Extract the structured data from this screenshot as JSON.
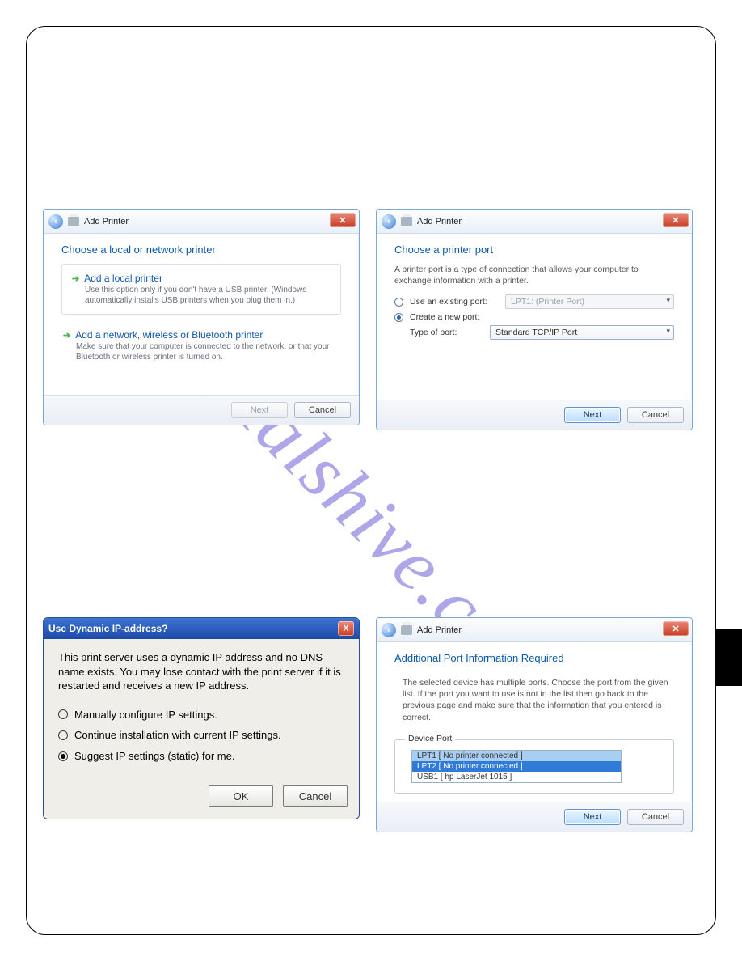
{
  "watermark": "manualshive.com",
  "wiz1": {
    "title": "Add Printer",
    "heading": "Choose a local or network printer",
    "opt1_title": "Add a local printer",
    "opt1_sub": "Use this option only if you don't have a USB printer. (Windows automatically installs USB printers when you plug them in.)",
    "opt2_title": "Add a network, wireless or Bluetooth printer",
    "opt2_sub": "Make sure that your computer is connected to the network, or that your Bluetooth or wireless printer is turned on.",
    "next": "Next",
    "cancel": "Cancel"
  },
  "wiz2": {
    "title": "Add Printer",
    "heading": "Choose a printer port",
    "desc": "A printer port is a type of connection that allows your computer to exchange information with a printer.",
    "use_existing": "Use an existing port:",
    "existing_val": "LPT1: (Printer Port)",
    "create_new": "Create a new port:",
    "type_of_port": "Type of port:",
    "port_type_val": "Standard TCP/IP Port",
    "next": "Next",
    "cancel": "Cancel"
  },
  "xp": {
    "title": "Use Dynamic IP-address?",
    "body": "This print server uses a dynamic IP address and no DNS name exists. You may lose contact with the print server if it is restarted and receives a new IP address.",
    "r1": "Manually configure IP settings.",
    "r2": "Continue installation with current IP settings.",
    "r3": "Suggest IP settings (static) for me.",
    "ok": "OK",
    "cancel": "Cancel"
  },
  "wiz3": {
    "title": "Add Printer",
    "heading": "Additional Port Information Required",
    "desc": "The selected device has multiple ports. Choose the port from the given list. If the port you want to use is not in the list then go back to the previous page and make sure that the information that you entered is correct.",
    "fieldset_label": "Device Port",
    "list": {
      "row1": "LPT1 [ No printer connected ]",
      "row2": "LPT2 [ No printer connected ]",
      "row3": "USB1 [ hp LaserJet 1015 ]"
    },
    "next": "Next",
    "cancel": "Cancel"
  }
}
